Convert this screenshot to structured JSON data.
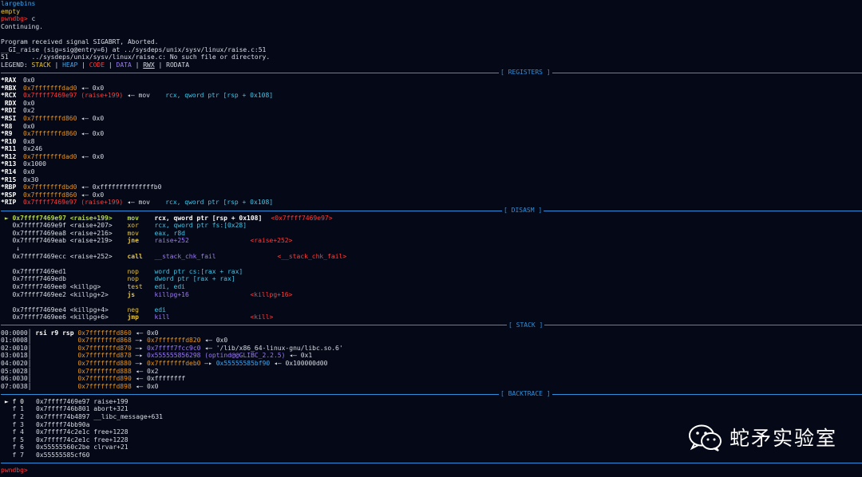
{
  "top_lines": [
    "largebins",
    "empty"
  ],
  "prompt": "pwndbg>",
  "cmd_c": "c",
  "continuing": "Continuing.",
  "signal_line": "Program received signal SIGABRT, Aborted.",
  "gi_raise_line": "__GI_raise (sig=sig@entry=6) at ../sysdeps/unix/sysv/linux/raise.c:51",
  "nosuch_line": "51\t../sysdeps/unix/sysv/linux/raise.c: No such file or directory.",
  "legend": {
    "label": "LEGEND: ",
    "stack": "STACK",
    "heap": "HEAP",
    "code": "CODE",
    "data": "DATA",
    "rwx": "RWX",
    "rodata": "RODATA",
    "sep": " | "
  },
  "sections": {
    "registers": "[ REGISTERS ]",
    "disasm": "[ DISASM ]",
    "stack": "[ STACK ]",
    "backtrace": "[ BACKTRACE ]"
  },
  "registers": [
    {
      "name": "*RAX",
      "val": "0x0",
      "kind": "plain"
    },
    {
      "name": "*RBX",
      "val": "0x7fffffffdad0",
      "kind": "stack",
      "rest": " ◂— 0x0"
    },
    {
      "name": "*RCX",
      "val": "0x7ffff7469e97 (raise+199)",
      "kind": "code",
      "rest": " ◂— mov    ",
      "ins": "rcx, qword ptr [rsp + 0x108]"
    },
    {
      "name": " RDX",
      "val": "0x0",
      "kind": "plain"
    },
    {
      "name": "*RDI",
      "val": "0x2",
      "kind": "plain"
    },
    {
      "name": "*RSI",
      "val": "0x7fffffffd860",
      "kind": "stack",
      "rest": " ◂— 0x0"
    },
    {
      "name": "*R8",
      "val": "0x0",
      "kind": "plain"
    },
    {
      "name": "*R9",
      "val": "0x7fffffffd860",
      "kind": "stack",
      "rest": " ◂— 0x0"
    },
    {
      "name": "*R10",
      "val": "0x8",
      "kind": "plain"
    },
    {
      "name": "*R11",
      "val": "0x246",
      "kind": "plain"
    },
    {
      "name": "*R12",
      "val": "0x7fffffffdad0",
      "kind": "stack",
      "rest": " ◂— 0x0"
    },
    {
      "name": "*R13",
      "val": "0x1000",
      "kind": "plain"
    },
    {
      "name": "*R14",
      "val": "0x0",
      "kind": "plain"
    },
    {
      "name": "*R15",
      "val": "0x30",
      "kind": "plain"
    },
    {
      "name": "*RBP",
      "val": "0x7fffffffdbd0",
      "kind": "stack",
      "rest": " ◂— 0xffffffffffffffb0"
    },
    {
      "name": "*RSP",
      "val": "0x7fffffffd860",
      "kind": "stack",
      "rest": " ◂— 0x0"
    },
    {
      "name": "*RIP",
      "val": "0x7ffff7469e97 (raise+199)",
      "kind": "code",
      "rest": " ◂— mov    ",
      "ins": "rcx, qword ptr [rsp + 0x108]"
    }
  ],
  "disasm": [
    {
      "arrow": " ► ",
      "addr": "0x7ffff7469e97 <raise+199>",
      "mn": "mov",
      "ops": "rcx, qword ptr [rsp + 0x108]",
      "target": "<0x7ffff7469e97>",
      "current": true
    },
    {
      "arrow": "   ",
      "addr": "0x7ffff7469e9f <raise+207>",
      "mn": "xor",
      "ops": "rcx, qword ptr fs:[0x28]"
    },
    {
      "arrow": "   ",
      "addr": "0x7ffff7469ea8 <raise+216>",
      "mn": "mov",
      "ops": "eax, r8d"
    },
    {
      "arrow": "   ",
      "addr": "0x7ffff7469eab <raise+219>",
      "mn": "jne",
      "ops": "raise+252",
      "target": "<raise+252>",
      "jump": true
    },
    {
      "arrow": "    ",
      "addr": "↓",
      "mn": "",
      "ops": ""
    },
    {
      "arrow": "   ",
      "addr": "0x7ffff7469ecc <raise+252>",
      "mn": "call",
      "ops": "__stack_chk_fail",
      "target": "<__stack_chk_fail>",
      "jump": true
    },
    {
      "arrow": "",
      "addr": "",
      "mn": "",
      "ops": ""
    },
    {
      "arrow": "   ",
      "addr": "0x7ffff7469ed1",
      "mn": "nop",
      "ops": "word ptr cs:[rax + rax]"
    },
    {
      "arrow": "   ",
      "addr": "0x7ffff7469edb",
      "mn": "nop",
      "ops": "dword ptr [rax + rax]"
    },
    {
      "arrow": "   ",
      "addr": "0x7ffff7469ee0 <killpg>",
      "mn": "test",
      "ops": "edi, edi"
    },
    {
      "arrow": "   ",
      "addr": "0x7ffff7469ee2 <killpg+2>",
      "mn": "js",
      "ops": "killpg+16",
      "target": "<killpg+16>",
      "jump": true
    },
    {
      "arrow": "",
      "addr": "",
      "mn": "",
      "ops": ""
    },
    {
      "arrow": "   ",
      "addr": "0x7ffff7469ee4 <killpg+4>",
      "mn": "neg",
      "ops": "edi"
    },
    {
      "arrow": "   ",
      "addr": "0x7ffff7469ee6 <killpg+6>",
      "mn": "jmp",
      "ops": "kill",
      "target": "<kill>",
      "jump": true
    }
  ],
  "stack": [
    {
      "off": "00:0000│",
      "regs": " rsi r9 rsp ",
      "addr": "0x7fffffffd860",
      "rest": " ◂— 0x0"
    },
    {
      "off": "01:0008│",
      "regs": "            ",
      "addr": "0x7fffffffd868",
      "a2": " —▸ ",
      "v2": "0x7fffffffd820",
      "v2k": "stack",
      "rest": " ◂— 0x0"
    },
    {
      "off": "02:0010│",
      "regs": "            ",
      "addr": "0x7fffffffd870",
      "a2": " —▸ ",
      "v2": "0x7ffff7fcc9c0",
      "v2k": "data",
      "rest": " ◂— '/lib/x86_64-linux-gnu/libc.so.6'"
    },
    {
      "off": "03:0018│",
      "regs": "            ",
      "addr": "0x7fffffffd878",
      "a2": " —▸ ",
      "v2": "0x555555856298 (optind@@GLIBC_2.2.5)",
      "v2k": "data",
      "rest": " ◂— 0x1"
    },
    {
      "off": "04:0020│",
      "regs": "            ",
      "addr": "0x7fffffffd880",
      "a2": " —▸ ",
      "v2": "0x7fffffffdeb0",
      "v2k": "stack",
      "a3": " —▸ ",
      "v3": "0x55555585bf90",
      "rest": " ◂— 0x100000d00"
    },
    {
      "off": "05:0028│",
      "regs": "            ",
      "addr": "0x7fffffffd888",
      "rest": " ◂— 0x2"
    },
    {
      "off": "06:0030│",
      "regs": "            ",
      "addr": "0x7fffffffd890",
      "rest": " ◂— 0xffffffff"
    },
    {
      "off": "07:0038│",
      "regs": "            ",
      "addr": "0x7fffffffd898",
      "rest": " ◂— 0x0"
    }
  ],
  "backtrace": [
    {
      "mark": " ► f 0",
      "addr": "0x7ffff7469e97",
      "fn": "raise+199"
    },
    {
      "mark": "   f 1",
      "addr": "0x7ffff746b801",
      "fn": "abort+321"
    },
    {
      "mark": "   f 2",
      "addr": "0x7ffff74b4897",
      "fn": "__libc_message+631"
    },
    {
      "mark": "   f 3",
      "addr": "0x7ffff74bb90a",
      "fn": ""
    },
    {
      "mark": "   f 4",
      "addr": "0x7ffff74c2e1c",
      "fn": "free+1228"
    },
    {
      "mark": "   f 5",
      "addr": "0x7ffff74c2e1c",
      "fn": "free+1228"
    },
    {
      "mark": "   f 6",
      "addr": "0x55555560c2be",
      "fn": "clrvar+21"
    },
    {
      "mark": "   f 7",
      "addr": "0x55555585cf60",
      "fn": ""
    }
  ],
  "watermark": "蛇矛实验室",
  "watermark_icon": "wechat-icon",
  "colors": {
    "background": "#050816",
    "separator": "#2f8fd8",
    "stack": "#e8c53c",
    "heap": "#3fa6ee",
    "code": "#ff3b3b",
    "data": "#9a7cf3",
    "prompt": "#ff3b3b"
  }
}
